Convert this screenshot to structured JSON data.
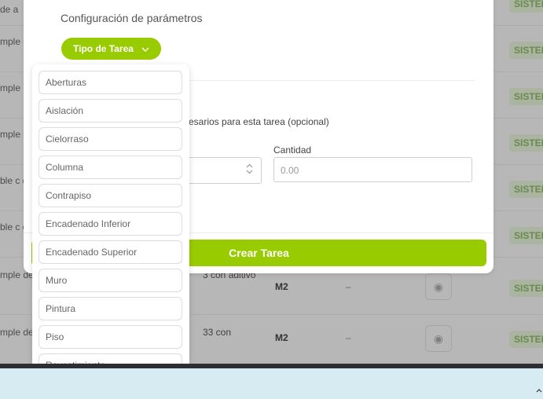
{
  "background_table": {
    "rows": [
      {
        "left_text": "de a",
        "badge": "SISTEM"
      },
      {
        "left_text": "mple de a",
        "badge": "SISTEM"
      },
      {
        "left_text": "mple de a",
        "badge": "SISTEM"
      },
      {
        "left_text": "mple de a",
        "badge": "SISTEM"
      },
      {
        "left_text": "ble c de a",
        "badge": "SISTEM"
      },
      {
        "left_text": "ble c o con",
        "badge": "SISTEM"
      },
      {
        "left_text": "mple de de asie ante/al",
        "desc": "3 con aditivo",
        "unit": "M2",
        "dash": "–",
        "badge": "SISTEM"
      },
      {
        "left_text": "mple de de asie",
        "desc": "33 con",
        "unit": "M2",
        "dash": "–",
        "badge": "SISTEM"
      }
    ]
  },
  "modal": {
    "title": "Configuración de parámetros",
    "type_button_label": "Tipo de Tarea",
    "help_text": "esarios para esta tarea (opcional)",
    "quantity_label": "Cantidad",
    "quantity_placeholder": "0.00",
    "create_button_label": "Crear Tarea"
  },
  "dropdown": {
    "options": [
      "Aberturas",
      "Aislación",
      "Cielorraso",
      "Columna",
      "Contrapiso",
      "Encadenado Inferior",
      "Encadenado Superior",
      "Muro",
      "Pintura",
      "Piso",
      "Revestimiento"
    ]
  },
  "colors": {
    "accent": "#99cc00",
    "footer_bg": "#d7ecf2"
  },
  "icons": {
    "type_chevron": "chevron-down-icon",
    "select_caret": "up-down-caret-icon",
    "view": "eye-icon"
  }
}
